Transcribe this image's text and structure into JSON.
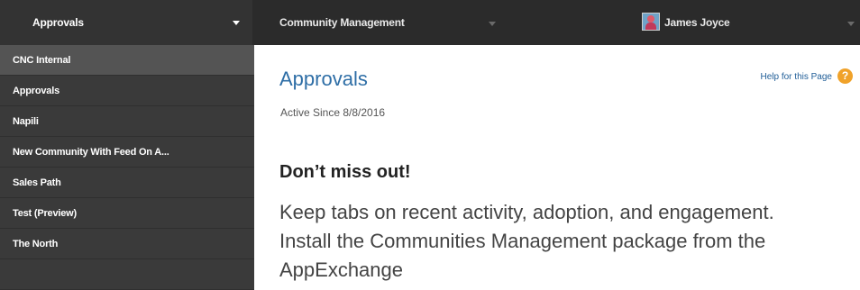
{
  "topbar": {
    "app_switcher": {
      "label": "Approvals",
      "icon": "chevron-down-icon"
    },
    "community_menu": {
      "label": "Community Management",
      "icon": "chevron-down-icon"
    },
    "user_menu": {
      "name": "James Joyce",
      "icon": "chevron-down-icon",
      "avatar": "user-avatar"
    }
  },
  "sidebar": {
    "items": [
      {
        "label": "CNC Internal",
        "active": true
      },
      {
        "label": "Approvals"
      },
      {
        "label": "Napili"
      },
      {
        "label": "New Community With Feed On A..."
      },
      {
        "label": "Sales Path"
      },
      {
        "label": "Test (Preview)"
      },
      {
        "label": "The North"
      },
      {
        "label": ""
      }
    ]
  },
  "main": {
    "title": "Approvals",
    "active_since": "Active Since 8/8/2016",
    "help_link": "Help for this Page",
    "help_icon": "?",
    "promo": {
      "heading": "Don’t miss out!",
      "body": "Keep tabs on recent activity, adoption, and engagement. Install the Communities Management package from the AppExchange"
    }
  },
  "colors": {
    "topbar_bg": "#2b2b2b",
    "sidebar_bg": "#3a3a3a",
    "sidebar_active_bg": "#545454",
    "title_blue": "#2e6ea6",
    "help_orange": "#f0a22a"
  }
}
